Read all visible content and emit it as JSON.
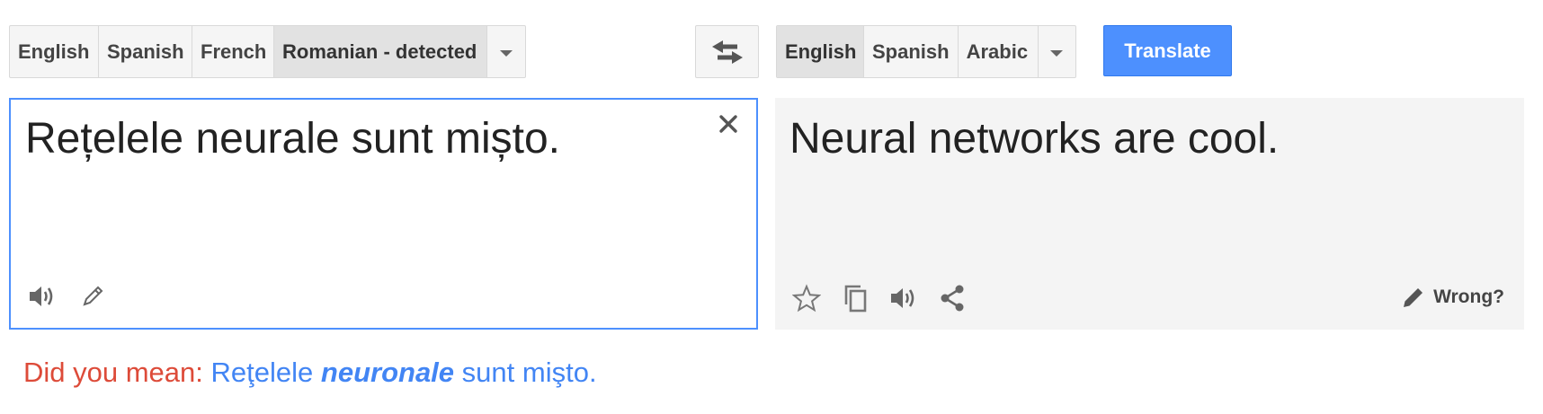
{
  "source": {
    "languages": [
      "English",
      "Spanish",
      "French",
      "Romanian - detected"
    ],
    "active_index": 3,
    "text": "Rețelele neurale sunt mișto."
  },
  "target": {
    "languages": [
      "English",
      "Spanish",
      "Arabic"
    ],
    "active_index": 0,
    "text": "Neural networks are cool.",
    "wrong_label": "Wrong?"
  },
  "buttons": {
    "translate_label": "Translate"
  },
  "suggestion": {
    "label": "Did you mean:",
    "before": "Reţelele",
    "emphasis": "neuronale",
    "after": "sunt mişto."
  },
  "colors": {
    "accent": "#4d90fe",
    "suggestion_label": "#dd4b39",
    "suggestion_link": "#4285f4"
  },
  "icons": {
    "swap": "swap-icon",
    "clear": "close-icon",
    "listen": "speaker-icon",
    "handwrite": "pencil-icon",
    "star": "star-icon",
    "copy": "copy-icon",
    "share": "share-icon",
    "edit": "edit-pencil-icon"
  }
}
